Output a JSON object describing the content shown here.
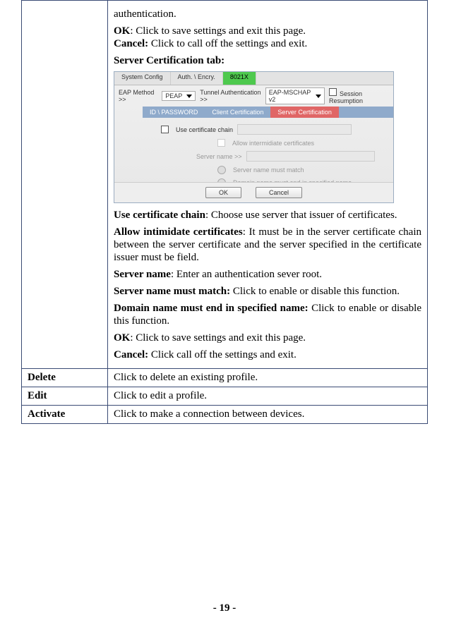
{
  "main_cell": {
    "line0": "authentication.",
    "ok1_label": "OK",
    "ok1_text": ": Click to save settings and exit this page.",
    "cancel1_label": "Cancel:",
    "cancel1_text": " Click to call off the settings and exit.",
    "sct_heading": "Server Certification tab:",
    "ucc_label": "Use certificate chain",
    "ucc_text": ": Choose use server that issuer of certificates.",
    "aic_label": "Allow intimidate certificates",
    "aic_text": ": It must be in the server certificate chain between the server certificate and the server specified in the certificate issuer must be field.",
    "sn_label": "Server name",
    "sn_text": ": Enter an authentication sever root.",
    "snm_label": "Server name must match:",
    "snm_text": " Click to enable or disable this function.",
    "dnm_label": "Domain name must end in specified name:",
    "dnm_text": " Click to enable or disable this function.",
    "ok2_label": "OK",
    "ok2_text": ": Click to save settings and exit this page.",
    "cancel2_label": "Cancel:",
    "cancel2_text": " Click call off the settings and exit."
  },
  "rows": {
    "delete_label": "Delete",
    "delete_text": "Click to delete an existing profile.",
    "edit_label": "Edit",
    "edit_text": "Click to edit a profile.",
    "activate_label": "Activate",
    "activate_text": "Click to make a connection between devices."
  },
  "shot": {
    "tabs": {
      "t1": "System Config",
      "t2": "Auth. \\ Encry.",
      "t3": "8021X"
    },
    "eap_label": "EAP Method >>",
    "eap_value": "PEAP",
    "tunnel_label": "Tunnel Authentication >>",
    "tunnel_value": "EAP-MSCHAP v2",
    "session": "Session Resumption",
    "sub1": "ID \\ PASSWORD",
    "sub2": "Client Certification",
    "sub3": "Server Certification",
    "use_chain": "Use certificate chain",
    "allow_int": "Allow intermidiate certificates",
    "server_name_lbl": "Server name >>",
    "opt1": "Server name must match",
    "opt2": "Domain name must end in specified name",
    "ok": "OK",
    "cancel": "Cancel"
  },
  "page_number": "- 19 -"
}
